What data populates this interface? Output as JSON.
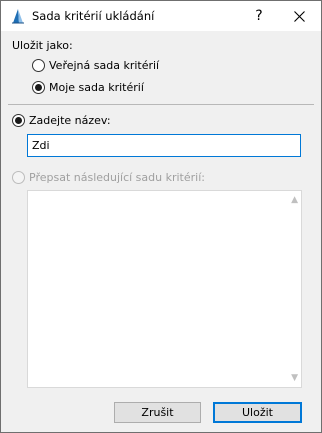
{
  "window": {
    "title": "Sada kritérií ukládání",
    "help_glyph": "?"
  },
  "save_as": {
    "label": "Uložit jako:",
    "options": [
      {
        "label": "Veřejná sada kritérií",
        "checked": false
      },
      {
        "label": "Moje sada kritérií",
        "checked": true
      }
    ]
  },
  "name_option": {
    "label": "Zadejte název:",
    "checked": true,
    "value": "Zdi"
  },
  "overwrite_option": {
    "label": "Přepsat následující sadu kritérií:",
    "checked": false,
    "enabled": false
  },
  "buttons": {
    "cancel": "Zrušit",
    "save": "Uložit"
  },
  "colors": {
    "accent": "#0078d7",
    "disabled_text": "#a0a0a0"
  }
}
